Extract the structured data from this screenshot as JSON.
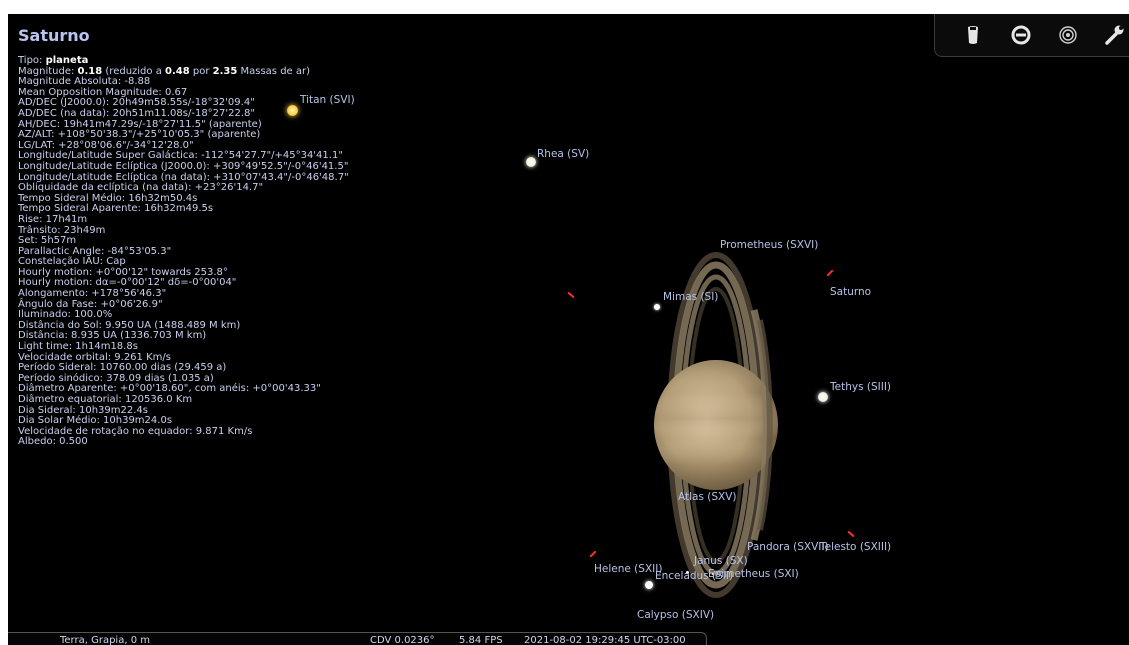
{
  "object": {
    "title": "Saturno",
    "info_lines": [
      [
        {
          "t": "Tipo: "
        },
        {
          "t": "planeta",
          "b": true
        }
      ],
      [
        {
          "t": "Magnitude: "
        },
        {
          "t": "0.18",
          "b": true
        },
        {
          "t": " (reduzido a "
        },
        {
          "t": "0.48",
          "b": true
        },
        {
          "t": " por "
        },
        {
          "t": "2.35",
          "b": true
        },
        {
          "t": " Massas de ar)"
        }
      ],
      [
        {
          "t": "Magnitude Absoluta: -8.88"
        }
      ],
      [
        {
          "t": "Mean Opposition Magnitude: 0.67"
        }
      ],
      [
        {
          "t": "AD/DEC (J2000.0): 20h49m58.55s/-18°32'09.4\""
        }
      ],
      [
        {
          "t": "AD/DEC (na data): 20h51m11.08s/-18°27'22.8\""
        }
      ],
      [
        {
          "t": "AH/DEC: 19h41m47.29s/-18°27'11.5\" (aparente)"
        }
      ],
      [
        {
          "t": "AZ/ALT: +108°50'38.3\"/+25°10'05.3\" (aparente)"
        }
      ],
      [
        {
          "t": "LG/LAT: +28°08'06.6\"/-34°12'28.0\""
        }
      ],
      [
        {
          "t": "Longitude/Latitude Super Galáctica: -112°54'27.7\"/+45°34'41.1\""
        }
      ],
      [
        {
          "t": "Longitude/Latitude Eclíptica (J2000.0): +309°49'52.5\"/-0°46'41.5\""
        }
      ],
      [
        {
          "t": "Longitude/Latitude Eclíptica (na data): +310°07'43.4\"/-0°46'48.7\""
        }
      ],
      [
        {
          "t": "Obliquidade da eclíptica (na data): +23°26'14.7\""
        }
      ],
      [
        {
          "t": "Tempo Sideral Médio: 16h32m50.4s"
        }
      ],
      [
        {
          "t": "Tempo Sideral Aparente: 16h32m49.5s"
        }
      ],
      [
        {
          "t": "Rise: 17h41m"
        }
      ],
      [
        {
          "t": "Trânsito: 23h49m"
        }
      ],
      [
        {
          "t": "Set: 5h57m"
        }
      ],
      [
        {
          "t": "Parallactic Angle: -84°53'05.3\""
        }
      ],
      [
        {
          "t": "Constelação IAU: Cap"
        }
      ],
      [
        {
          "t": "Hourly motion: +0°00'12\" towards 253.8°"
        }
      ],
      [
        {
          "t": "Hourly motion: dα=-0°00'12\" dδ=-0°00'04\""
        }
      ],
      [
        {
          "t": "Alongamento: +178°56'46.3\""
        }
      ],
      [
        {
          "t": "Ângulo da Fase: +0°06'26.9\""
        }
      ],
      [
        {
          "t": "Iluminado: 100.0%"
        }
      ],
      [
        {
          "t": "Distância do Sol: 9.950 UA (1488.489 M km)"
        }
      ],
      [
        {
          "t": "Distância: 8.935 UA (1336.703 M km)"
        }
      ],
      [
        {
          "t": "Light time: 1h14m18.8s"
        }
      ],
      [
        {
          "t": "Velocidade orbital: 9.261 Km/s"
        }
      ],
      [
        {
          "t": "Período Sideral: 10760.00 dias (29.459 a)"
        }
      ],
      [
        {
          "t": "Período sinódico: 378.09 dias (1.035 a)"
        }
      ],
      [
        {
          "t": "Diâmetro Aparente: +0°00'18.60\", com anéis: +0°00'43.33\""
        }
      ],
      [
        {
          "t": "Diâmetro equatorial: 120536.0 Km"
        }
      ],
      [
        {
          "t": "Dia Sideral: 10h39m22.4s"
        }
      ],
      [
        {
          "t": "Dia Solar Médio: 10h39m24.0s"
        }
      ],
      [
        {
          "t": "Velocidade de rotação no equador: 9.871 Km/s"
        }
      ],
      [
        {
          "t": "Albedo: 0.500"
        }
      ]
    ]
  },
  "labels": {
    "titan": "Titan (SVI)",
    "rhea": "Rhea (SV)",
    "prometheus_xvi": "Prometheus (SXVI)",
    "saturno": "Saturno",
    "mimas": "Mimas (SI)",
    "tethys": "Tethys (SIII)",
    "atlas": "Atlas (SXV)",
    "pandora": "Pandora (SXVII)",
    "telesto": "Telesto (SXIII)",
    "janus": "Janus (SX)",
    "helene": "Helene (SXII)",
    "enceladus": "Enceladus (SII)",
    "epimetheus": "Epimetheus (SXI)",
    "calypso": "Calypso (SXIV)"
  },
  "status": {
    "location": "Terra, Grapia, 0 m",
    "fov": "CDV 0.0236°",
    "fps": "5.84 FPS",
    "datetime": "2021-08-02 19:29:45 UTC-03:00"
  },
  "toolbar": {
    "icons": [
      "eraser-icon",
      "quit-icon",
      "target-icon",
      "wrench-icon"
    ]
  },
  "colors": {
    "sky": "#000000",
    "title": "#b9c4ef",
    "info_text": "#c8d0ee",
    "label_text": "#b7c2e6",
    "marker": "#ff2a2a"
  }
}
